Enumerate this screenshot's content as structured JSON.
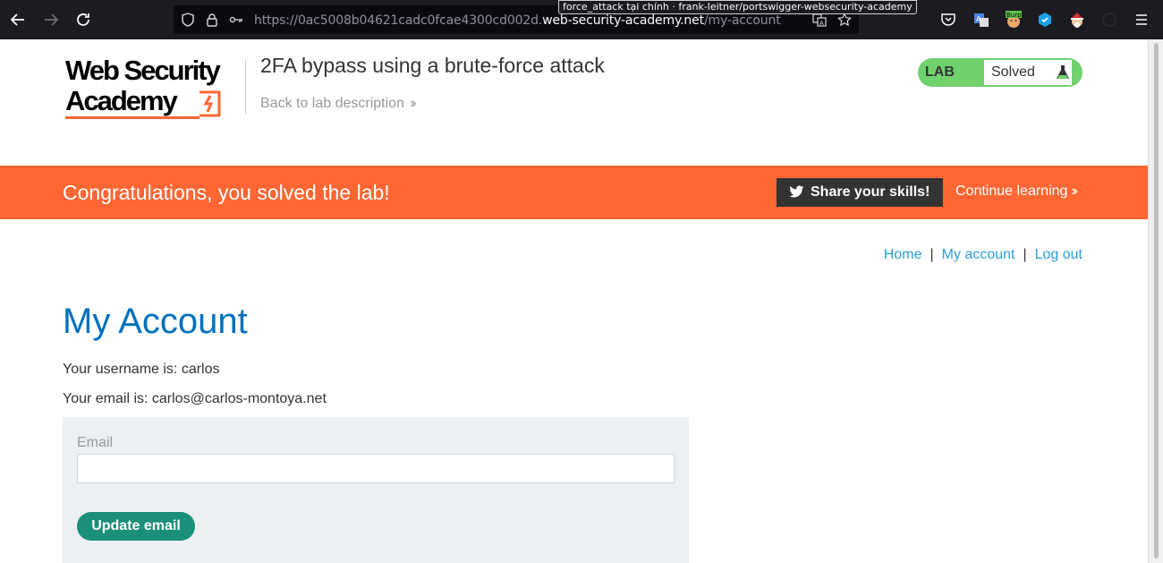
{
  "browser": {
    "url_prefix": "https://0ac5008b04621cadc0fcae4300cd002d.",
    "url_host": "web-security-academy.net",
    "url_path": "/my-account",
    "tooltip": "force_attack tại chính · frank-leitner/portswigger-websecurity-academy",
    "ext_burp_label": "Burp"
  },
  "header": {
    "logo_line1": "Web Security",
    "logo_line2": "Academy",
    "lab_title": "2FA bypass using a brute-force attack",
    "back_link": "Back to lab description",
    "lab_badge_label": "LAB",
    "lab_status": "Solved"
  },
  "banner": {
    "message": "Congratulations, you solved the lab!",
    "share_label": "Share your skills!",
    "continue_label": "Continue learning"
  },
  "nav": {
    "home": "Home",
    "my_account": "My account",
    "log_out": "Log out",
    "separator": "|"
  },
  "account": {
    "heading": "My Account",
    "username_line": "Your username is: carlos",
    "email_line": "Your email is: carlos@carlos-montoya.net",
    "email_label": "Email",
    "email_value": "",
    "update_button": "Update email"
  },
  "colors": {
    "banner": "#ff6633",
    "heading": "#0071bc",
    "link": "#29a0d8",
    "lab_badge": "#70d16d",
    "update_button": "#1a8f7a"
  }
}
